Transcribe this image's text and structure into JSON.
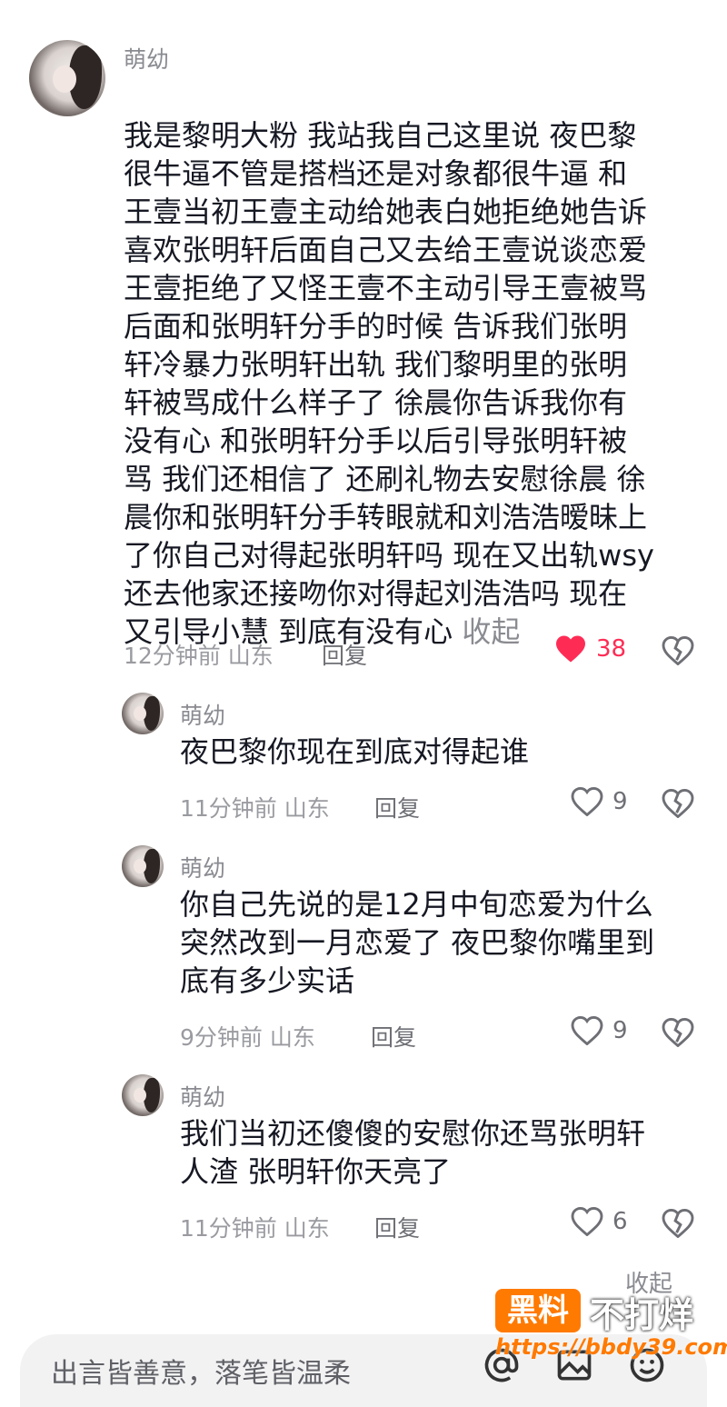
{
  "comments": [
    {
      "username": "萌幼",
      "text": "我是黎明大粉 我站我自己这里说 夜巴黎\n很牛逼不管是搭档还是对象都很牛逼 和\n王壹当初王壹主动给她表白她拒绝她告诉\n喜欢张明轩后面自己又去给王壹说谈恋爱\n王壹拒绝了又怪王壹不主动引导王壹被骂\n后面和张明轩分手的时候 告诉我们张明\n轩冷暴力张明轩出轨 我们黎明里的张明\n轩被骂成什么样子了 徐晨你告诉我你有\n没有心 和张明轩分手以后引导张明轩被\n骂 我们还相信了 还刷礼物去安慰徐晨 徐\n晨你和张明轩分手转眼就和刘浩浩暧昧上\n了你自己对得起张明轩吗 现在又出轨wsy\n还去他家还接吻你对得起刘浩浩吗 现在\n又引导小慧 到底有没有心 ",
      "collapse_label": "收起",
      "time": "12分钟前",
      "location": "山东",
      "reply_label": "回复",
      "likes": "38",
      "liked": true
    },
    {
      "username": "萌幼",
      "text": "夜巴黎你现在到底对得起谁",
      "time": "11分钟前",
      "location": "山东",
      "reply_label": "回复",
      "likes": "9",
      "liked": false
    },
    {
      "username": "萌幼",
      "text": "你自己先说的是12月中旬恋爱为什么\n突然改到一月恋爱了 夜巴黎你嘴里到\n底有多少实话",
      "time": "9分钟前",
      "location": "山东",
      "reply_label": "回复",
      "likes": "9",
      "liked": false
    },
    {
      "username": "萌幼",
      "text": "我们当初还傻傻的安慰你还骂张明轩\n人渣 张明轩你天亮了",
      "time": "11分钟前",
      "location": "山东",
      "reply_label": "回复",
      "likes": "6",
      "liked": false
    }
  ],
  "collapse_replies_label": "收起",
  "input": {
    "placeholder": "出言皆善意，落笔皆温柔"
  },
  "watermark": {
    "badge": "黑料",
    "text": "不打烊",
    "url": "https://bbdy39.com"
  },
  "colors": {
    "like_active": "#fe2c55",
    "meta": "#9a9ba0",
    "watermark": "#ff7a00"
  },
  "icons": [
    "heart-filled-icon",
    "heart-outline-icon",
    "broken-heart-icon",
    "at-icon",
    "image-icon",
    "emoji-icon"
  ]
}
